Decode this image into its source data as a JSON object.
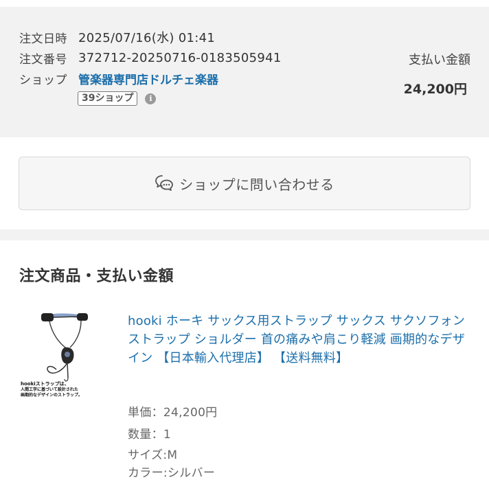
{
  "order": {
    "date_label": "注文日時",
    "date_value": "2025/07/16(水) 01:41",
    "number_label": "注文番号",
    "number_value": "372712-20250716-0183505941",
    "shop_label": "ショップ",
    "shop_name": "管楽器専門店ドルチェ楽器",
    "shop_badge": "39ショップ",
    "info_icon": "i"
  },
  "payment": {
    "label": "支払い金額",
    "amount": "24,200円"
  },
  "contact": {
    "button_label": "ショップに問い合わせる",
    "icon": "chat-bubble-icon"
  },
  "items_section": {
    "title": "注文商品・支払い金額",
    "items": [
      {
        "title": "hooki ホーキ サックス用ストラップ サックス サクソフォン ストラップ ショルダー 首の痛みや肩こり軽減 画期的なデザイン 【日本輸入代理店】 【送料無料】",
        "thumb_caption": [
          "hookiストラップは、",
          "人間工学に基づいて設計された",
          "画期的なデザインのストラップ。"
        ],
        "unit_price": "単価：24,200円",
        "quantity": "数量：1",
        "size": "サイズ:M",
        "color": "カラー:シルバー"
      }
    ]
  },
  "colors": {
    "link": "#1c6fab",
    "summary_bg": "#f2f2f2",
    "text": "#333333"
  }
}
